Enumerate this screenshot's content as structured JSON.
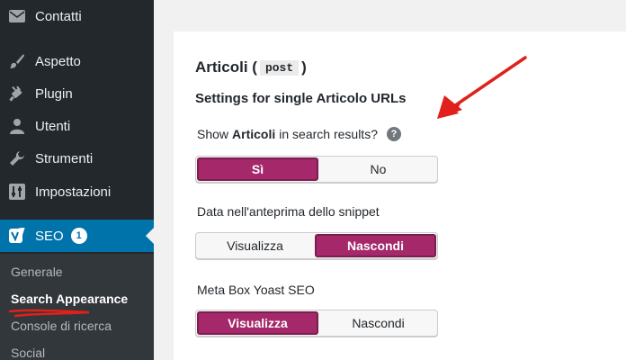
{
  "sidebar": {
    "items": [
      {
        "label": "Contatti",
        "icon": "mail-icon"
      },
      {
        "label": "Aspetto",
        "icon": "brush-icon"
      },
      {
        "label": "Plugin",
        "icon": "plugin-icon"
      },
      {
        "label": "Utenti",
        "icon": "user-icon"
      },
      {
        "label": "Strumenti",
        "icon": "wrench-icon"
      },
      {
        "label": "Impostazioni",
        "icon": "settings-icon"
      }
    ],
    "seo": {
      "label": "SEO",
      "badge": "1",
      "icon": "yoast-icon"
    },
    "submenu": [
      {
        "label": "Generale"
      },
      {
        "label": "Search Appearance"
      },
      {
        "label": "Console di ricerca"
      },
      {
        "label": "Social"
      }
    ]
  },
  "panel": {
    "title_prefix": "Articoli (",
    "title_code": "post",
    "title_suffix": ")",
    "subtitle": "Settings for single Articolo URLs",
    "fields": [
      {
        "label_pre": "Show",
        "label_bold": "Articoli",
        "label_post": "in search results?",
        "options": [
          "Sì",
          "No"
        ],
        "selected": "Sì"
      },
      {
        "label": "Data nell'anteprima dello snippet",
        "options": [
          "Visualizza",
          "Nascondi"
        ],
        "selected": "Nascondi"
      },
      {
        "label": "Meta Box Yoast SEO",
        "options": [
          "Visualizza",
          "Nascondi"
        ],
        "selected": "Visualizza"
      }
    ]
  },
  "colors": {
    "sidebar_bg": "#23282d",
    "seo_active": "#0073aa",
    "toggle_active": "#a4286a",
    "annotation_red": "#e0211b"
  }
}
